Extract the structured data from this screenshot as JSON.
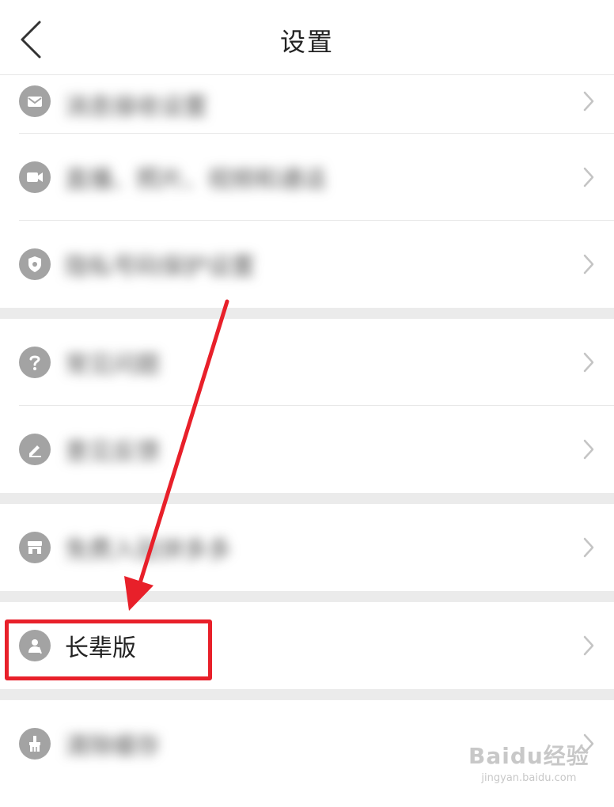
{
  "header": {
    "title": "设置"
  },
  "groups": [
    {
      "items": [
        {
          "icon": "mail-icon",
          "label": "消息接收设置",
          "blurred": true
        },
        {
          "icon": "video-icon",
          "label": "直播、照片、视频和通话",
          "blurred": true
        },
        {
          "icon": "shield-icon",
          "label": "隐私号码保护设置",
          "blurred": true
        }
      ]
    },
    {
      "items": [
        {
          "icon": "question-icon",
          "label": "常见问题",
          "blurred": true
        },
        {
          "icon": "pen-icon",
          "label": "意见反馈",
          "blurred": true
        }
      ]
    },
    {
      "items": [
        {
          "icon": "store-icon",
          "label": "免费入驻拼多多",
          "blurred": true
        }
      ]
    },
    {
      "items": [
        {
          "icon": "elder-icon",
          "label": "长辈版",
          "blurred": false
        }
      ]
    },
    {
      "items": [
        {
          "icon": "broom-icon",
          "label": "清除缓存",
          "blurred": true
        }
      ]
    }
  ],
  "watermark": {
    "logo": "Baidu经验",
    "url": "jingyan.baidu.com"
  },
  "colors": {
    "highlight": "#e8202a",
    "icon_bg": "#a3a3a3",
    "divider": "#ebebeb"
  }
}
